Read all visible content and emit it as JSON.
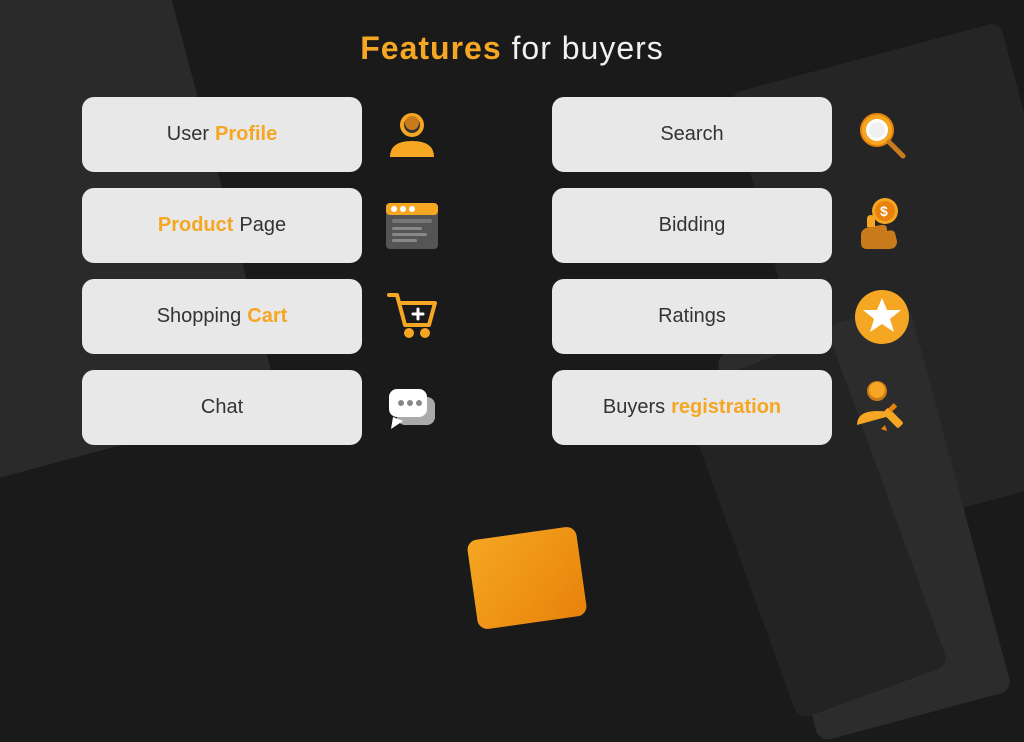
{
  "page": {
    "title_plain": " for buyers",
    "title_highlight": "Features",
    "bg_color": "#1a1a1a"
  },
  "features": [
    {
      "id": "user-profile",
      "label_plain": "User ",
      "label_highlight": "Profile",
      "highlight_position": "right",
      "col": "left",
      "row": 1,
      "icon": "person"
    },
    {
      "id": "search",
      "label_plain": "Search",
      "label_highlight": "",
      "highlight_position": "none",
      "col": "right",
      "row": 1,
      "icon": "search"
    },
    {
      "id": "product-page",
      "label_plain": " Page",
      "label_highlight": "Product",
      "highlight_position": "left",
      "col": "left",
      "row": 2,
      "icon": "browser"
    },
    {
      "id": "bidding",
      "label_plain": "Bidding",
      "label_highlight": "",
      "highlight_position": "none",
      "col": "right",
      "row": 2,
      "icon": "coin-hand"
    },
    {
      "id": "shopping-cart",
      "label_plain": "Shopping ",
      "label_highlight": "Cart",
      "highlight_position": "right",
      "col": "left",
      "row": 3,
      "icon": "cart"
    },
    {
      "id": "ratings",
      "label_plain": "Ratings",
      "label_highlight": "",
      "highlight_position": "none",
      "col": "right",
      "row": 3,
      "icon": "star"
    },
    {
      "id": "chat",
      "label_plain": "Chat",
      "label_highlight": "",
      "highlight_position": "none",
      "col": "left",
      "row": 4,
      "icon": "chat"
    },
    {
      "id": "buyers-registration",
      "label_plain": "Buyers ",
      "label_highlight": "registration",
      "highlight_position": "right",
      "col": "right",
      "row": 4,
      "icon": "person-write"
    }
  ]
}
